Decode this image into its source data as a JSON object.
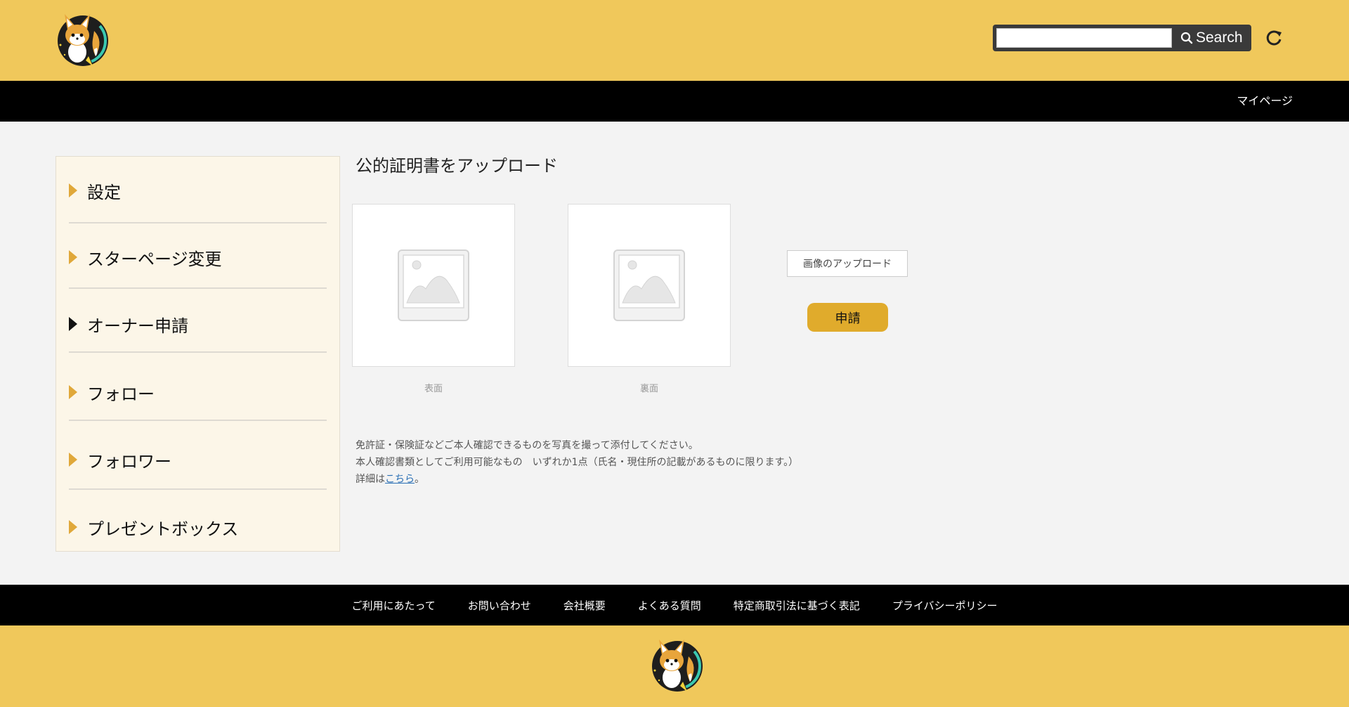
{
  "header": {
    "search_placeholder": "",
    "search_label": "Search"
  },
  "nav": {
    "mypage": "マイページ"
  },
  "sidebar": {
    "items": [
      {
        "label": "設定"
      },
      {
        "label": "スターページ変更"
      },
      {
        "label": "オーナー申請"
      },
      {
        "label": "フォロー"
      },
      {
        "label": "フォロワー"
      },
      {
        "label": "プレゼントボックス"
      }
    ]
  },
  "main": {
    "title": "公的証明書をアップロード",
    "front_caption": "表面",
    "back_caption": "裏面",
    "upload_label": "画像のアップロード",
    "apply_label": "申請",
    "info_line1": "免許証・保険証などご本人確認できるものを写真を撮って添付してください。",
    "info_line2": "本人確認書類としてご利用可能なもの　いずれか1点（氏名・現住所の記載があるものに限ります。）",
    "info_line3_prefix": "詳細は",
    "info_link": "こちら",
    "info_line3_suffix": "。"
  },
  "footer": {
    "links": [
      "ご利用にあたって",
      "お問い合わせ",
      "会社概要",
      "よくある質問",
      "特定商取引法に基づく表記",
      "プライバシーポリシー"
    ]
  },
  "colors": {
    "brand_yellow": "#f0c85b",
    "accent_gold": "#e0ab2c",
    "bar_black": "#000000"
  }
}
